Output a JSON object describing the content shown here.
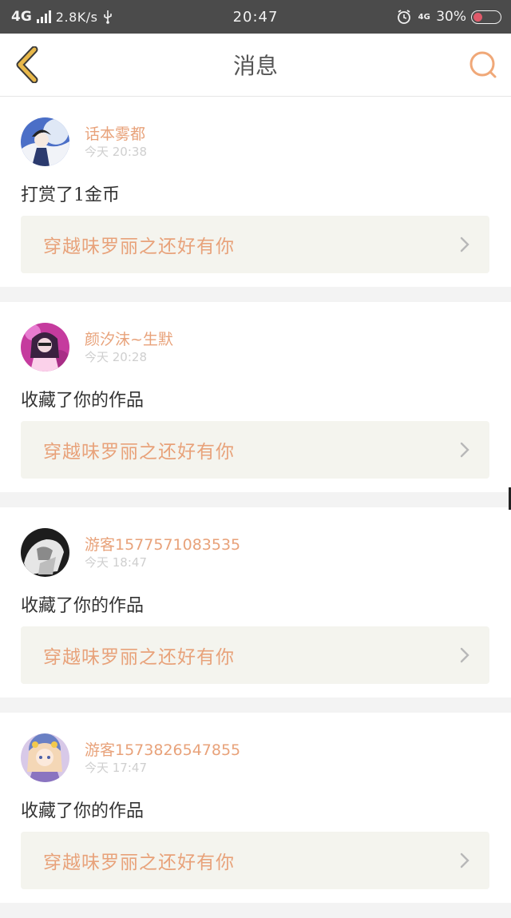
{
  "status_bar": {
    "network": "4G",
    "speed": "2.8K/s",
    "time": "20:47",
    "network_small": "4G",
    "battery": "30%",
    "colors": {
      "background": "#4b4b4b",
      "battery_fill": "#e05a6a"
    }
  },
  "header": {
    "title": "消息",
    "back_icon": "chevron-left-icon",
    "search_icon": "search-icon",
    "accent_color": "#e8b84a",
    "search_color": "#f0a878"
  },
  "messages": [
    {
      "user": "话本雾都",
      "time": "今天 20:38",
      "action": "打赏了1金币",
      "work": "穿越味罗丽之还好有你"
    },
    {
      "user": "颜汐沫~生默",
      "time": "今天 20:28",
      "action": "收藏了你的作品",
      "work": "穿越味罗丽之还好有你"
    },
    {
      "user": "游客1577571083535",
      "time": "今天 18:47",
      "action": "收藏了你的作品",
      "work": "穿越味罗丽之还好有你"
    },
    {
      "user": "游客1573826547855",
      "time": "今天 17:47",
      "action": "收藏了你的作品",
      "work": "穿越味罗丽之还好有你"
    }
  ],
  "colors": {
    "username": "#e8a27a",
    "work_title": "#e8a27a",
    "work_bg": "#f4f4ee",
    "page_bg": "#f3f3f3"
  }
}
